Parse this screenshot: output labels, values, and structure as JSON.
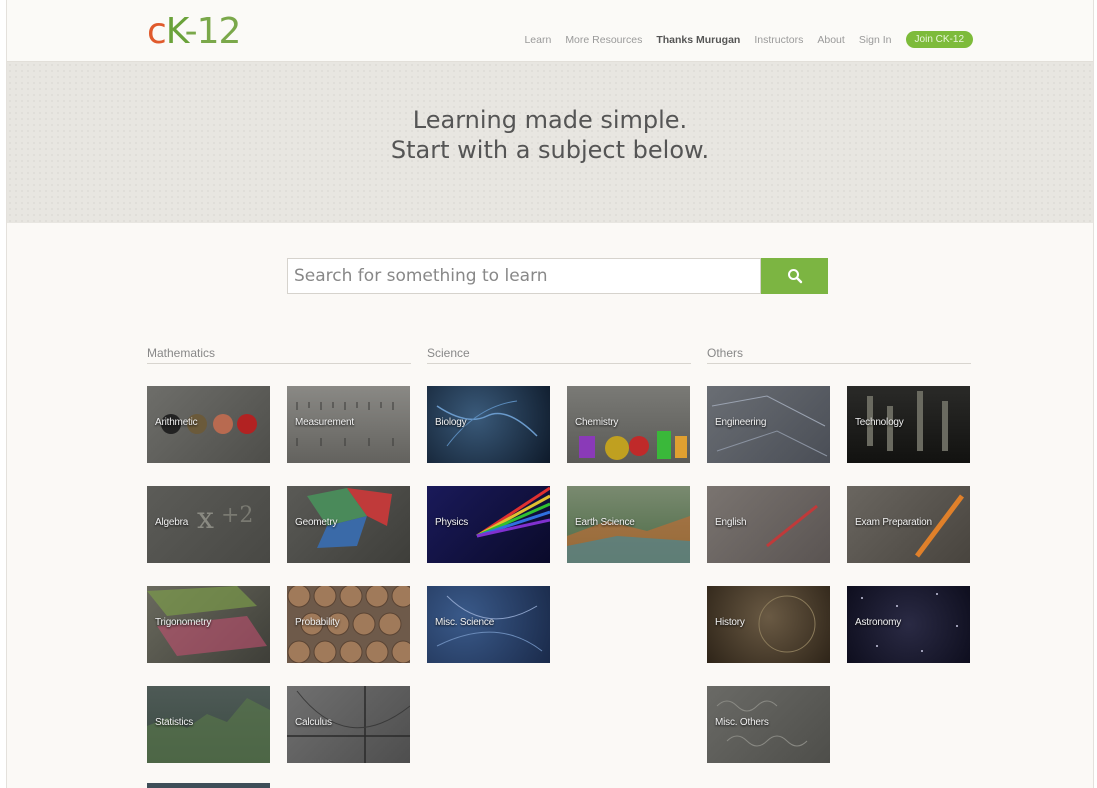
{
  "header": {
    "logo": {
      "c": "c",
      "k": "K",
      "rest": "-12"
    },
    "nav": [
      "Learn",
      "More Resources",
      "Thanks Murugan",
      "Instructors",
      "About",
      "Sign In"
    ],
    "join_label": "Join CK-12"
  },
  "hero": {
    "line1": "Learning made simple.",
    "line2": "Start with a subject below."
  },
  "search": {
    "placeholder": "Search for something to learn",
    "button_icon": "search-icon"
  },
  "sections": {
    "mathematics": "Mathematics",
    "science": "Science",
    "others": "Others"
  },
  "subjects": {
    "arithmetic": "Arithmetic",
    "measurement": "Measurement",
    "algebra": "Algebra",
    "geometry": "Geometry",
    "trigonometry": "Trigonometry",
    "probability": "Probability",
    "statistics": "Statistics",
    "calculus": "Calculus",
    "biology": "Biology",
    "chemistry": "Chemistry",
    "physics": "Physics",
    "earth_science": "Earth Science",
    "misc_science": "Misc. Science",
    "engineering": "Engineering",
    "technology": "Technology",
    "english": "English",
    "exam_preparation": "Exam Preparation",
    "history": "History",
    "astronomy": "Astronomy",
    "misc_others": "Misc. Others"
  },
  "colors": {
    "accent_green": "#7cb542",
    "logo_orange": "#e05a2c"
  }
}
